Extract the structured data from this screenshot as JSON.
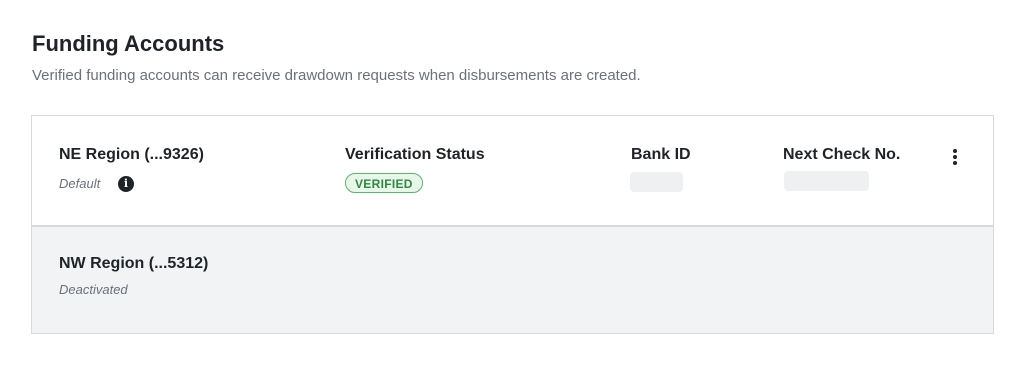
{
  "header": {
    "title": "Funding Accounts",
    "subtitle": "Verified funding accounts can receive drawdown requests when disbursements are created."
  },
  "accounts": [
    {
      "name": "NE Region (...9326)",
      "sub_label": "Default",
      "info_icon": "info-icon",
      "columns": {
        "verification_status_label": "Verification Status",
        "verification_status_value": "VERIFIED",
        "bank_id_label": "Bank ID",
        "next_check_label": "Next Check No."
      },
      "menu_icon": "more-vertical-icon"
    },
    {
      "name": "NW Region (...5312)",
      "sub_label": "Deactivated"
    }
  ],
  "colors": {
    "verified_text": "#2e8a3e",
    "verified_bg": "#e9f6ea",
    "verified_border": "#5bb66a",
    "deactivated_row_bg": "#f2f3f5"
  }
}
